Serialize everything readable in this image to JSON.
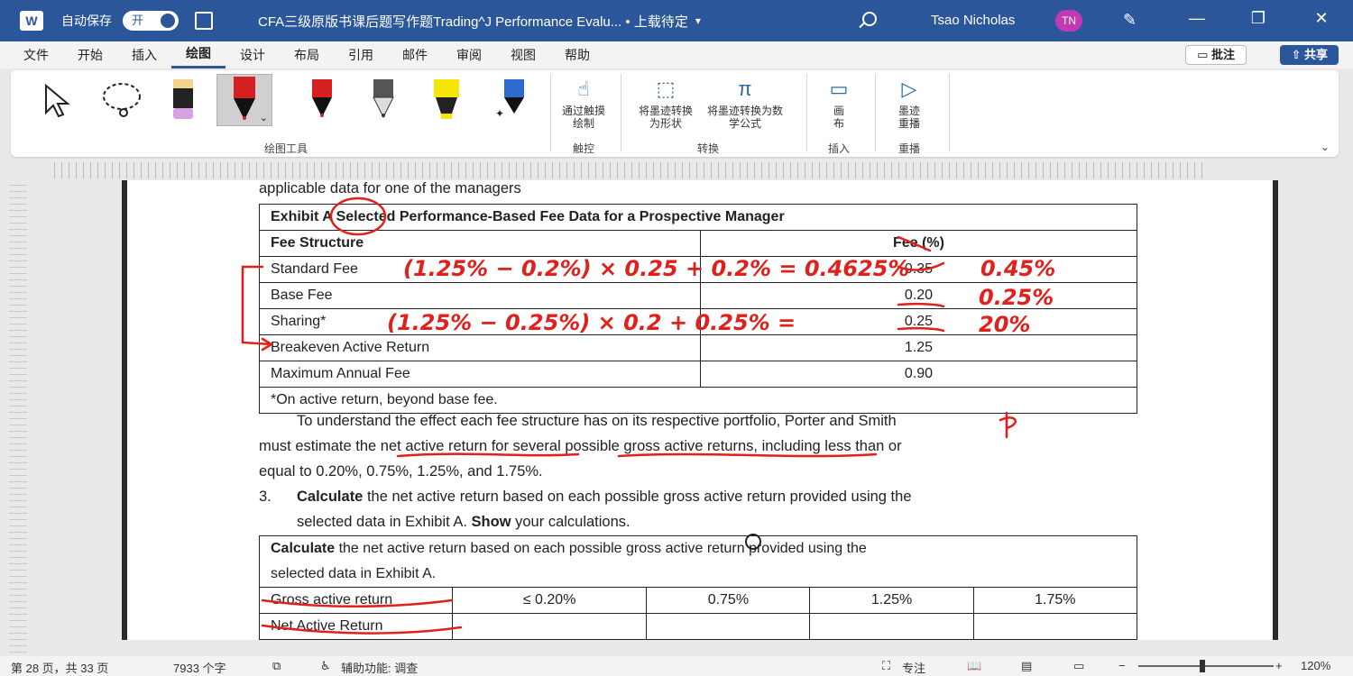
{
  "titlebar": {
    "app_icon": "word-icon",
    "autosave_label": "自动保存",
    "autosave_state": "开",
    "doc_title": "CFA三级原版书课后题写作题Trading^J Performance Evalu... • 上载待定",
    "user_name": "Tsao Nicholas",
    "user_initials": "TN",
    "accent": "#2b579a"
  },
  "menu": {
    "tabs": [
      "文件",
      "开始",
      "插入",
      "绘图",
      "设计",
      "布局",
      "引用",
      "邮件",
      "审阅",
      "视图",
      "帮助"
    ],
    "active": "绘图",
    "comment_label": "批注",
    "share_label": "共享"
  },
  "ribbon": {
    "groups": {
      "drawing_tools": "绘图工具",
      "touch": "触控",
      "convert": "转换",
      "insert": "插入",
      "replay": "重播"
    },
    "touch_draw": "通过触摸绘制",
    "ink_to_shape": "将墨迹转换为形状",
    "ink_to_math": "将墨迹转换为数学公式",
    "canvas": "画布",
    "ink_replay": "墨迹重播"
  },
  "document": {
    "intro_line": "applicable data for one of the managers",
    "exhibit_title": "Exhibit A Selected Performance-Based Fee Data for a Prospective Manager",
    "col_structure": "Fee Structure",
    "col_fee": "Fee (%)",
    "rows": [
      {
        "label": "Standard Fee",
        "fee": "0.35"
      },
      {
        "label": "Base Fee",
        "fee": "0.20"
      },
      {
        "label": "Sharing*",
        "fee": "0.25"
      },
      {
        "label": "Breakeven Active Return",
        "fee": "1.25"
      },
      {
        "label": "Maximum Annual Fee",
        "fee": "0.90"
      }
    ],
    "footnote": "*On active return, beyond base fee.",
    "para1": "To understand the effect each fee structure has on its respective portfolio, Porter and Smith",
    "para2": "must estimate the net active return for several possible gross active returns, including less than or",
    "para3": "equal to 0.20%, 0.75%, 1.25%, and 1.75%.",
    "q_num": "3.",
    "q_bold1": "Calculate",
    "q_text1": " the net active return based on each possible gross active return provided using the",
    "q_text2a": "selected data in Exhibit A. ",
    "q_bold2": "Show",
    "q_text2b": " your calculations.",
    "calc_bold": "Calculate",
    "calc_text1": " the net active return based on each possible gross active return provided using the",
    "calc_text2": "selected data in Exhibit A.",
    "gross_label": "Gross active return",
    "gross_values": [
      "≤ 0.20%",
      "0.75%",
      "1.25%",
      "1.75%"
    ],
    "net_label": "Net Active Return"
  },
  "ink": {
    "line1": "(1.25% − 0.2%) × 0.25 + 0.2% = 0.4625%",
    "line2": "(1.25% − 0.25%) × 0.2 + 0.25% =",
    "side1": "0.45%",
    "side2": "0.25%",
    "side3": "20%",
    "ink_color": "#e0201b"
  },
  "statusbar": {
    "page_info": "第 28 页，共 33 页",
    "word_count": "7933 个字",
    "accessibility": "辅助功能: 调查",
    "focus": "专注",
    "zoom": "120%"
  }
}
